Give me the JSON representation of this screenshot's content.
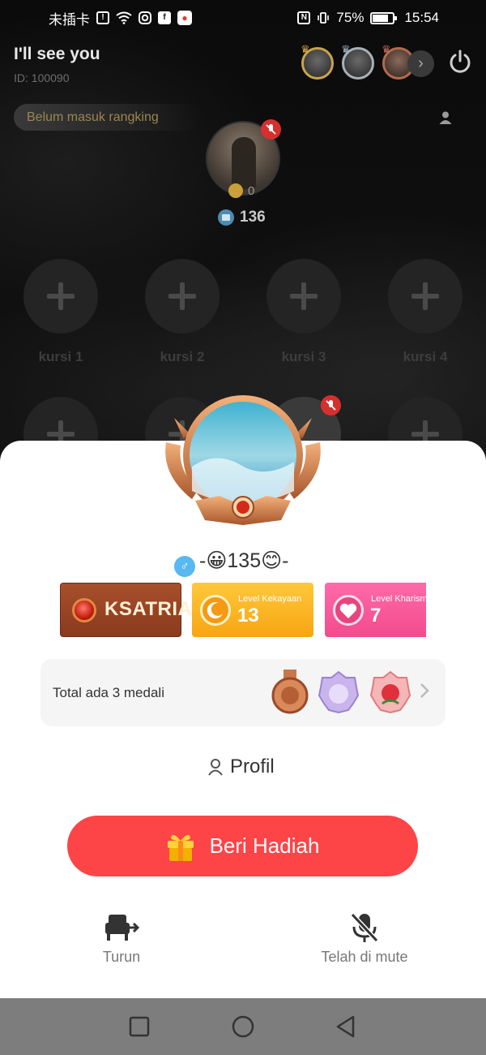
{
  "status_bar": {
    "carrier": "未插卡",
    "battery": "75%",
    "time": "15:54"
  },
  "room": {
    "title": "I'll see you",
    "id": "ID: 100090",
    "rank_label": "Belum masuk rangking",
    "host": {
      "score": "0",
      "count": "136"
    },
    "seats": [
      {
        "label": "kursi 1"
      },
      {
        "label": "kursi 2"
      },
      {
        "label": "kursi 3"
      },
      {
        "label": "kursi 4"
      }
    ]
  },
  "profile_sheet": {
    "nickname": "-😀135😊-",
    "gender": "♂",
    "badges": {
      "ksatria": "KSATRIA",
      "wealth_label": "Level Kekayaan",
      "wealth_value": "13",
      "charm_label": "Level Kharisma",
      "charm_value": "7"
    },
    "medals_text": "Total ada 3 medali",
    "profile_link": "Profil",
    "gift_button": "Beri Hadiah",
    "actions": {
      "down": "Turun",
      "mute": "Telah di mute"
    }
  },
  "colors": {
    "gift_button": "#fd4447",
    "wealth_badge": "#ffb82a",
    "charm_badge": "#f6559a",
    "ksatria_badge": "#9c4526"
  }
}
